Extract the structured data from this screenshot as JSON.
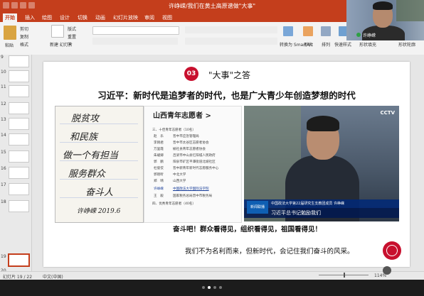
{
  "window": {
    "title": "许峥嵘/我们在黄土高原谱做\"大事\"",
    "minimize": "—",
    "maximize": "□",
    "close": "✕"
  },
  "tabs": [
    "开始",
    "插入",
    "绘图",
    "设计",
    "切换",
    "动画",
    "幻灯片放映",
    "审阅",
    "视图"
  ],
  "ribbon": {
    "cut": "剪切",
    "copy": "复制",
    "paste": "粘贴",
    "format": "格式",
    "new_slide": "新建\n幻灯片",
    "layout": "版式",
    "reset": "重置",
    "section": "节",
    "convert_smartart": "转换为\nSmartArt",
    "shapes": "形状",
    "arrange": "排列",
    "quick_styles": "快速样式",
    "fill": "形状填充",
    "outline": "形状轮廓"
  },
  "slides": {
    "numbers": [
      "9",
      "10",
      "11",
      "12",
      "13",
      "14",
      "15",
      "16",
      "17",
      "18",
      "19",
      "20"
    ],
    "selected": "19"
  },
  "slide": {
    "badge": "03",
    "heading": "\"大事\"之答",
    "quote": "习近平：新时代是追梦者的时代，也是广大青少年创造梦想的时代",
    "handwriting": [
      "脱贫攻",
      "和民族",
      "做一个有担当",
      "服务群众",
      "奋斗人",
      "许峥嵘 2019.6"
    ],
    "roster": {
      "title": "山西青年志愿者 >",
      "section_three": "三、十佳青年志愿者（10名）",
      "rows": [
        [
          "赵　乐",
          "晋中市应急管理局"
        ],
        [
          "李刚君",
          "晋中市太谷区志愿者协会"
        ],
        [
          "万里霞",
          "榆社县青年志愿者协会"
        ],
        [
          "朱峻卿",
          "吕梁市中山县忆阳城人民政府"
        ],
        [
          "郭　鹏",
          "阳泉市矿区平潭街道北坡社区"
        ],
        [
          "杜俊佼",
          "晋中新青年新时代志愿服务中心"
        ],
        [
          "郭晓昕",
          "中北大学"
        ],
        [
          "郑　晴",
          "山西大学"
        ],
        [
          "许峥嵘",
          "中国政法大学国际法学院"
        ],
        [
          "王　毅",
          "国家税务总局晋中市税务局"
        ]
      ],
      "section_four": "四、优秀青年志愿者（40名）"
    },
    "video": {
      "cctv": "CCTV",
      "logo": "新闻联播",
      "caption_top": "中国政法大学第22届研究生支教团成员 许峥嵘",
      "caption_main": "习近平总书记勉励我们"
    },
    "slogan1": "奋斗吧！群众看得见，组织看得见，祖国看得见！",
    "slogan2": "我们不为名利而来，但新时代，会记住我们奋斗的风采。"
  },
  "webcam": {
    "name": "许峥嵘"
  },
  "status": {
    "slide_counter": "幻灯片 19 / 22",
    "language": "中文(中国)",
    "zoom": "114%"
  },
  "colors": {
    "accent": "#c43e1c",
    "badge": "#c8102e"
  }
}
